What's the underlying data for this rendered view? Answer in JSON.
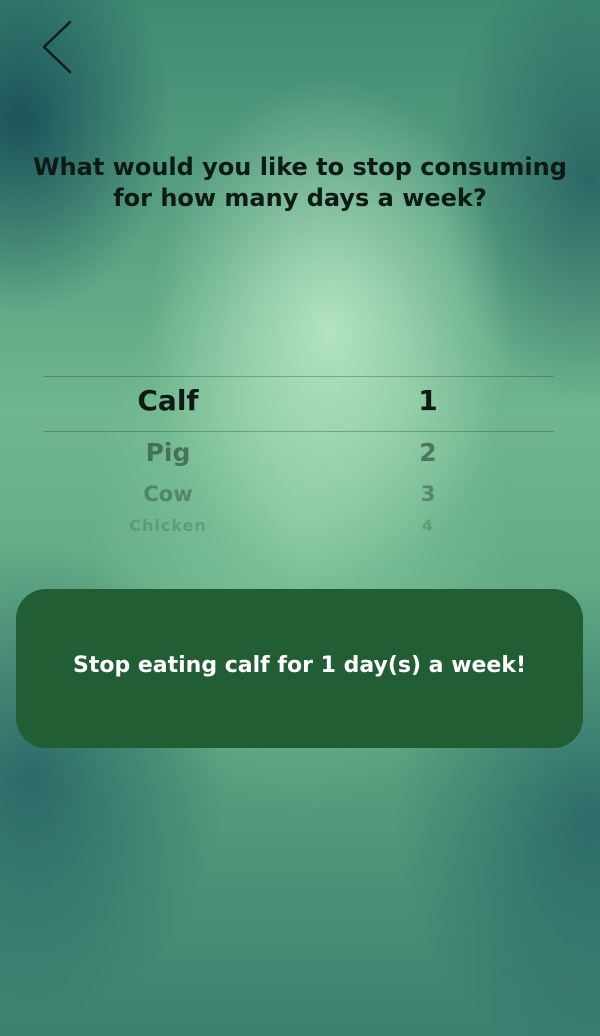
{
  "nav": {
    "back_icon": "chevron-left-icon"
  },
  "question": "What would you like to stop consuming for how many days a week?",
  "picker": {
    "rows": [
      {
        "animal": "Calf",
        "days": "1",
        "selected": true
      },
      {
        "animal": "Pig",
        "days": "2"
      },
      {
        "animal": "Cow",
        "days": "3"
      },
      {
        "animal": "Chicken",
        "days": "4"
      }
    ]
  },
  "result": {
    "text": "Stop eating calf for 1 day(s) a week!"
  },
  "colors": {
    "result_box": "#215e33",
    "result_text": "#ffffff",
    "question_text": "#0e1b14"
  }
}
